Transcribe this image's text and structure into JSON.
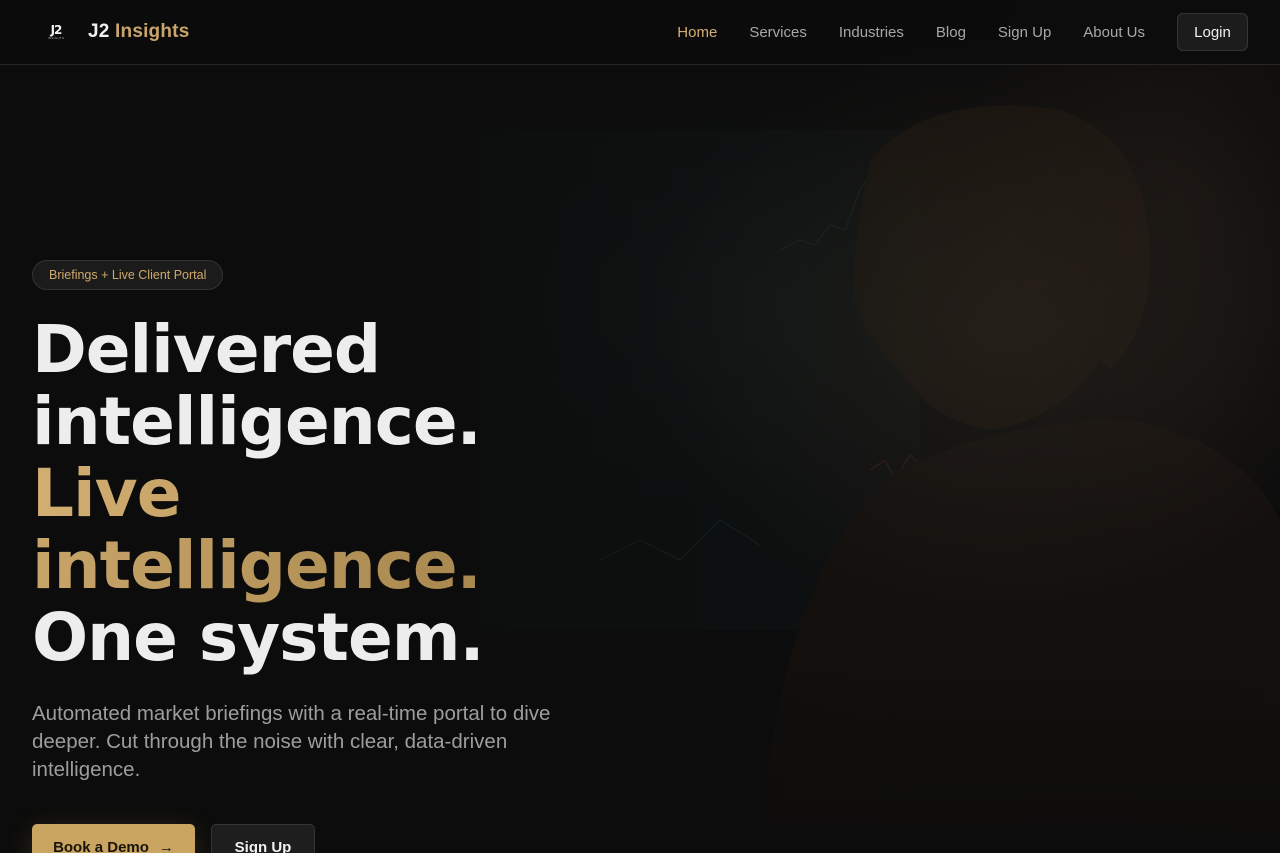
{
  "nav": {
    "logo_mark": "J2",
    "logo_tagline": "INSIGHTS",
    "brand_primary": "J2",
    "brand_secondary": "Insights",
    "links": [
      "Home",
      "Services",
      "Industries",
      "Blog",
      "Sign Up",
      "About Us"
    ],
    "active_link": "Home",
    "login_label": "Login"
  },
  "hero": {
    "badge": "Briefings + Live Client Portal",
    "headline_part1": "Delivered intelligence. ",
    "headline_part2": "Live intelligence.",
    "headline_part3": " One system.",
    "subtext": "Automated market briefings with a real-time portal to dive deeper. Cut through the noise with clear, data-driven intelligence.",
    "primary_cta": "Book a Demo",
    "primary_cta_icon": "arrow-right-icon",
    "secondary_cta": "Sign Up"
  },
  "colors": {
    "accent": "#c9a561",
    "background": "#0c0c0c",
    "text": "#ececec",
    "muted": "#9d9d9d"
  }
}
